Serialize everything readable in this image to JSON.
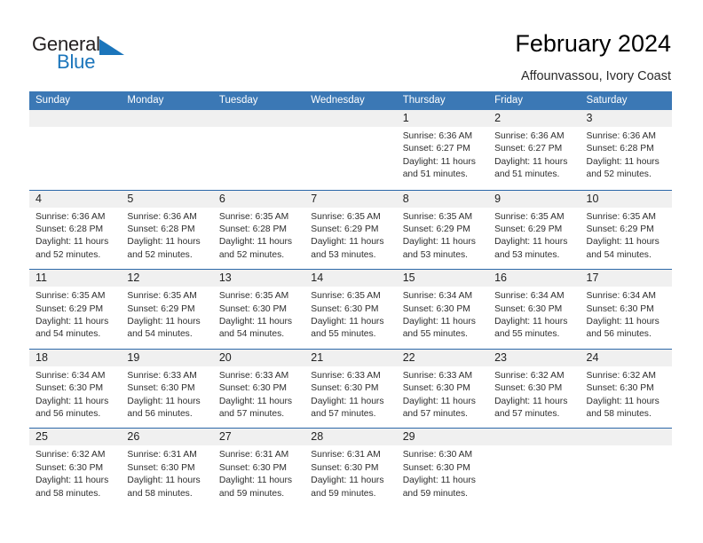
{
  "brand": {
    "name_part1": "General",
    "name_part2": "Blue"
  },
  "header": {
    "title": "February 2024",
    "subtitle": "Affounvassou, Ivory Coast"
  },
  "colors": {
    "header_blue": "#3b78b5",
    "week_divider_blue": "#2c68a8",
    "daynum_band": "#f0f0f0",
    "brand_blue": "#1b75bb"
  },
  "calendar": {
    "weekday_headers": [
      "Sunday",
      "Monday",
      "Tuesday",
      "Wednesday",
      "Thursday",
      "Friday",
      "Saturday"
    ],
    "weeks": [
      [
        {
          "empty": true
        },
        {
          "empty": true
        },
        {
          "empty": true
        },
        {
          "empty": true
        },
        {
          "day": "1",
          "sunrise": "Sunrise: 6:36 AM",
          "sunset": "Sunset: 6:27 PM",
          "daylight1": "Daylight: 11 hours",
          "daylight2": "and 51 minutes."
        },
        {
          "day": "2",
          "sunrise": "Sunrise: 6:36 AM",
          "sunset": "Sunset: 6:27 PM",
          "daylight1": "Daylight: 11 hours",
          "daylight2": "and 51 minutes."
        },
        {
          "day": "3",
          "sunrise": "Sunrise: 6:36 AM",
          "sunset": "Sunset: 6:28 PM",
          "daylight1": "Daylight: 11 hours",
          "daylight2": "and 52 minutes."
        }
      ],
      [
        {
          "day": "4",
          "sunrise": "Sunrise: 6:36 AM",
          "sunset": "Sunset: 6:28 PM",
          "daylight1": "Daylight: 11 hours",
          "daylight2": "and 52 minutes."
        },
        {
          "day": "5",
          "sunrise": "Sunrise: 6:36 AM",
          "sunset": "Sunset: 6:28 PM",
          "daylight1": "Daylight: 11 hours",
          "daylight2": "and 52 minutes."
        },
        {
          "day": "6",
          "sunrise": "Sunrise: 6:35 AM",
          "sunset": "Sunset: 6:28 PM",
          "daylight1": "Daylight: 11 hours",
          "daylight2": "and 52 minutes."
        },
        {
          "day": "7",
          "sunrise": "Sunrise: 6:35 AM",
          "sunset": "Sunset: 6:29 PM",
          "daylight1": "Daylight: 11 hours",
          "daylight2": "and 53 minutes."
        },
        {
          "day": "8",
          "sunrise": "Sunrise: 6:35 AM",
          "sunset": "Sunset: 6:29 PM",
          "daylight1": "Daylight: 11 hours",
          "daylight2": "and 53 minutes."
        },
        {
          "day": "9",
          "sunrise": "Sunrise: 6:35 AM",
          "sunset": "Sunset: 6:29 PM",
          "daylight1": "Daylight: 11 hours",
          "daylight2": "and 53 minutes."
        },
        {
          "day": "10",
          "sunrise": "Sunrise: 6:35 AM",
          "sunset": "Sunset: 6:29 PM",
          "daylight1": "Daylight: 11 hours",
          "daylight2": "and 54 minutes."
        }
      ],
      [
        {
          "day": "11",
          "sunrise": "Sunrise: 6:35 AM",
          "sunset": "Sunset: 6:29 PM",
          "daylight1": "Daylight: 11 hours",
          "daylight2": "and 54 minutes."
        },
        {
          "day": "12",
          "sunrise": "Sunrise: 6:35 AM",
          "sunset": "Sunset: 6:29 PM",
          "daylight1": "Daylight: 11 hours",
          "daylight2": "and 54 minutes."
        },
        {
          "day": "13",
          "sunrise": "Sunrise: 6:35 AM",
          "sunset": "Sunset: 6:30 PM",
          "daylight1": "Daylight: 11 hours",
          "daylight2": "and 54 minutes."
        },
        {
          "day": "14",
          "sunrise": "Sunrise: 6:35 AM",
          "sunset": "Sunset: 6:30 PM",
          "daylight1": "Daylight: 11 hours",
          "daylight2": "and 55 minutes."
        },
        {
          "day": "15",
          "sunrise": "Sunrise: 6:34 AM",
          "sunset": "Sunset: 6:30 PM",
          "daylight1": "Daylight: 11 hours",
          "daylight2": "and 55 minutes."
        },
        {
          "day": "16",
          "sunrise": "Sunrise: 6:34 AM",
          "sunset": "Sunset: 6:30 PM",
          "daylight1": "Daylight: 11 hours",
          "daylight2": "and 55 minutes."
        },
        {
          "day": "17",
          "sunrise": "Sunrise: 6:34 AM",
          "sunset": "Sunset: 6:30 PM",
          "daylight1": "Daylight: 11 hours",
          "daylight2": "and 56 minutes."
        }
      ],
      [
        {
          "day": "18",
          "sunrise": "Sunrise: 6:34 AM",
          "sunset": "Sunset: 6:30 PM",
          "daylight1": "Daylight: 11 hours",
          "daylight2": "and 56 minutes."
        },
        {
          "day": "19",
          "sunrise": "Sunrise: 6:33 AM",
          "sunset": "Sunset: 6:30 PM",
          "daylight1": "Daylight: 11 hours",
          "daylight2": "and 56 minutes."
        },
        {
          "day": "20",
          "sunrise": "Sunrise: 6:33 AM",
          "sunset": "Sunset: 6:30 PM",
          "daylight1": "Daylight: 11 hours",
          "daylight2": "and 57 minutes."
        },
        {
          "day": "21",
          "sunrise": "Sunrise: 6:33 AM",
          "sunset": "Sunset: 6:30 PM",
          "daylight1": "Daylight: 11 hours",
          "daylight2": "and 57 minutes."
        },
        {
          "day": "22",
          "sunrise": "Sunrise: 6:33 AM",
          "sunset": "Sunset: 6:30 PM",
          "daylight1": "Daylight: 11 hours",
          "daylight2": "and 57 minutes."
        },
        {
          "day": "23",
          "sunrise": "Sunrise: 6:32 AM",
          "sunset": "Sunset: 6:30 PM",
          "daylight1": "Daylight: 11 hours",
          "daylight2": "and 57 minutes."
        },
        {
          "day": "24",
          "sunrise": "Sunrise: 6:32 AM",
          "sunset": "Sunset: 6:30 PM",
          "daylight1": "Daylight: 11 hours",
          "daylight2": "and 58 minutes."
        }
      ],
      [
        {
          "day": "25",
          "sunrise": "Sunrise: 6:32 AM",
          "sunset": "Sunset: 6:30 PM",
          "daylight1": "Daylight: 11 hours",
          "daylight2": "and 58 minutes."
        },
        {
          "day": "26",
          "sunrise": "Sunrise: 6:31 AM",
          "sunset": "Sunset: 6:30 PM",
          "daylight1": "Daylight: 11 hours",
          "daylight2": "and 58 minutes."
        },
        {
          "day": "27",
          "sunrise": "Sunrise: 6:31 AM",
          "sunset": "Sunset: 6:30 PM",
          "daylight1": "Daylight: 11 hours",
          "daylight2": "and 59 minutes."
        },
        {
          "day": "28",
          "sunrise": "Sunrise: 6:31 AM",
          "sunset": "Sunset: 6:30 PM",
          "daylight1": "Daylight: 11 hours",
          "daylight2": "and 59 minutes."
        },
        {
          "day": "29",
          "sunrise": "Sunrise: 6:30 AM",
          "sunset": "Sunset: 6:30 PM",
          "daylight1": "Daylight: 11 hours",
          "daylight2": "and 59 minutes."
        },
        {
          "empty": true
        },
        {
          "empty": true
        }
      ]
    ]
  }
}
